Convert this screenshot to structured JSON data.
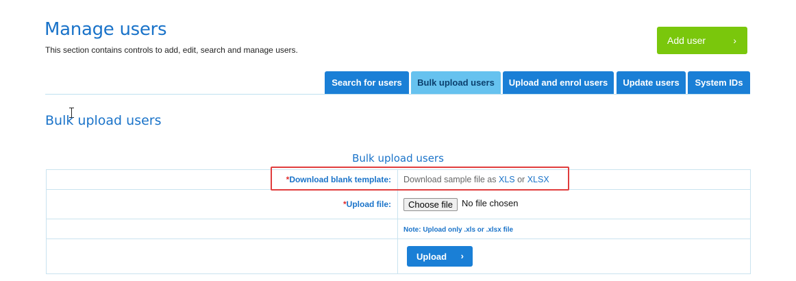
{
  "header": {
    "title": "Manage users",
    "description": "This section contains controls to add, edit, search and manage users.",
    "add_user_label": "Add user",
    "add_user_chevron": "›"
  },
  "tabs": [
    {
      "label": "Search for users",
      "active": false
    },
    {
      "label": "Bulk upload users",
      "active": true
    },
    {
      "label": "Upload and enrol users",
      "active": false
    },
    {
      "label": "Update users",
      "active": false
    },
    {
      "label": "System IDs",
      "active": false
    }
  ],
  "section": {
    "title": "Bulk upload users"
  },
  "form": {
    "caption": "Bulk upload users",
    "required_mark": "*",
    "download_label": "Download blank template:",
    "download_text": "Download sample file as",
    "download_xls": "XLS",
    "download_or": "or",
    "download_xlsx": "XLSX",
    "upload_label": "Upload file:",
    "choose_file_label": "Choose file",
    "no_file_text": "No file chosen",
    "note": "Note: Upload only .xls or .xlsx file",
    "upload_button": "Upload",
    "upload_chevron": "›"
  },
  "colors": {
    "brand_blue": "#1a7fd6",
    "active_tab": "#66c2ef",
    "add_user_green": "#7ac70c",
    "highlight_red": "#e03c3c"
  }
}
